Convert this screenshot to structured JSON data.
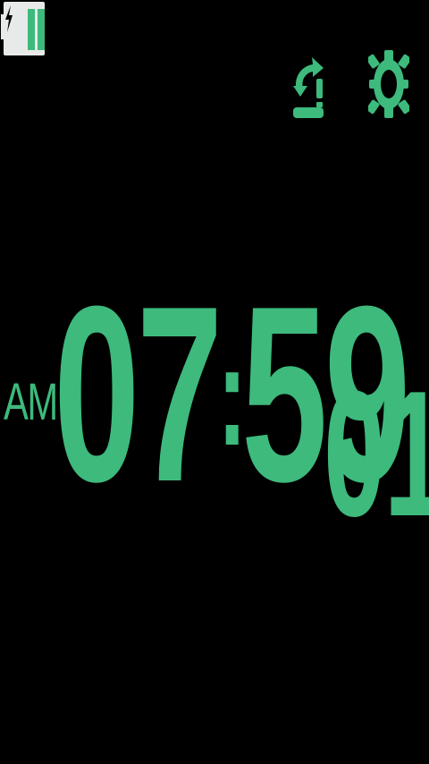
{
  "colors": {
    "background": "#000000",
    "accent": "#3dba7c",
    "battery_body": "#e8eaea"
  },
  "status_bar": {
    "battery": {
      "icon": "battery-charging-icon",
      "charging": true
    }
  },
  "toolbar": {
    "alarm_icon": "alarm-refresh-icon",
    "settings_icon": "gear-icon"
  },
  "clock": {
    "period": "AM",
    "hours": "07",
    "separator": ":",
    "minutes": "59",
    "seconds": "01"
  }
}
